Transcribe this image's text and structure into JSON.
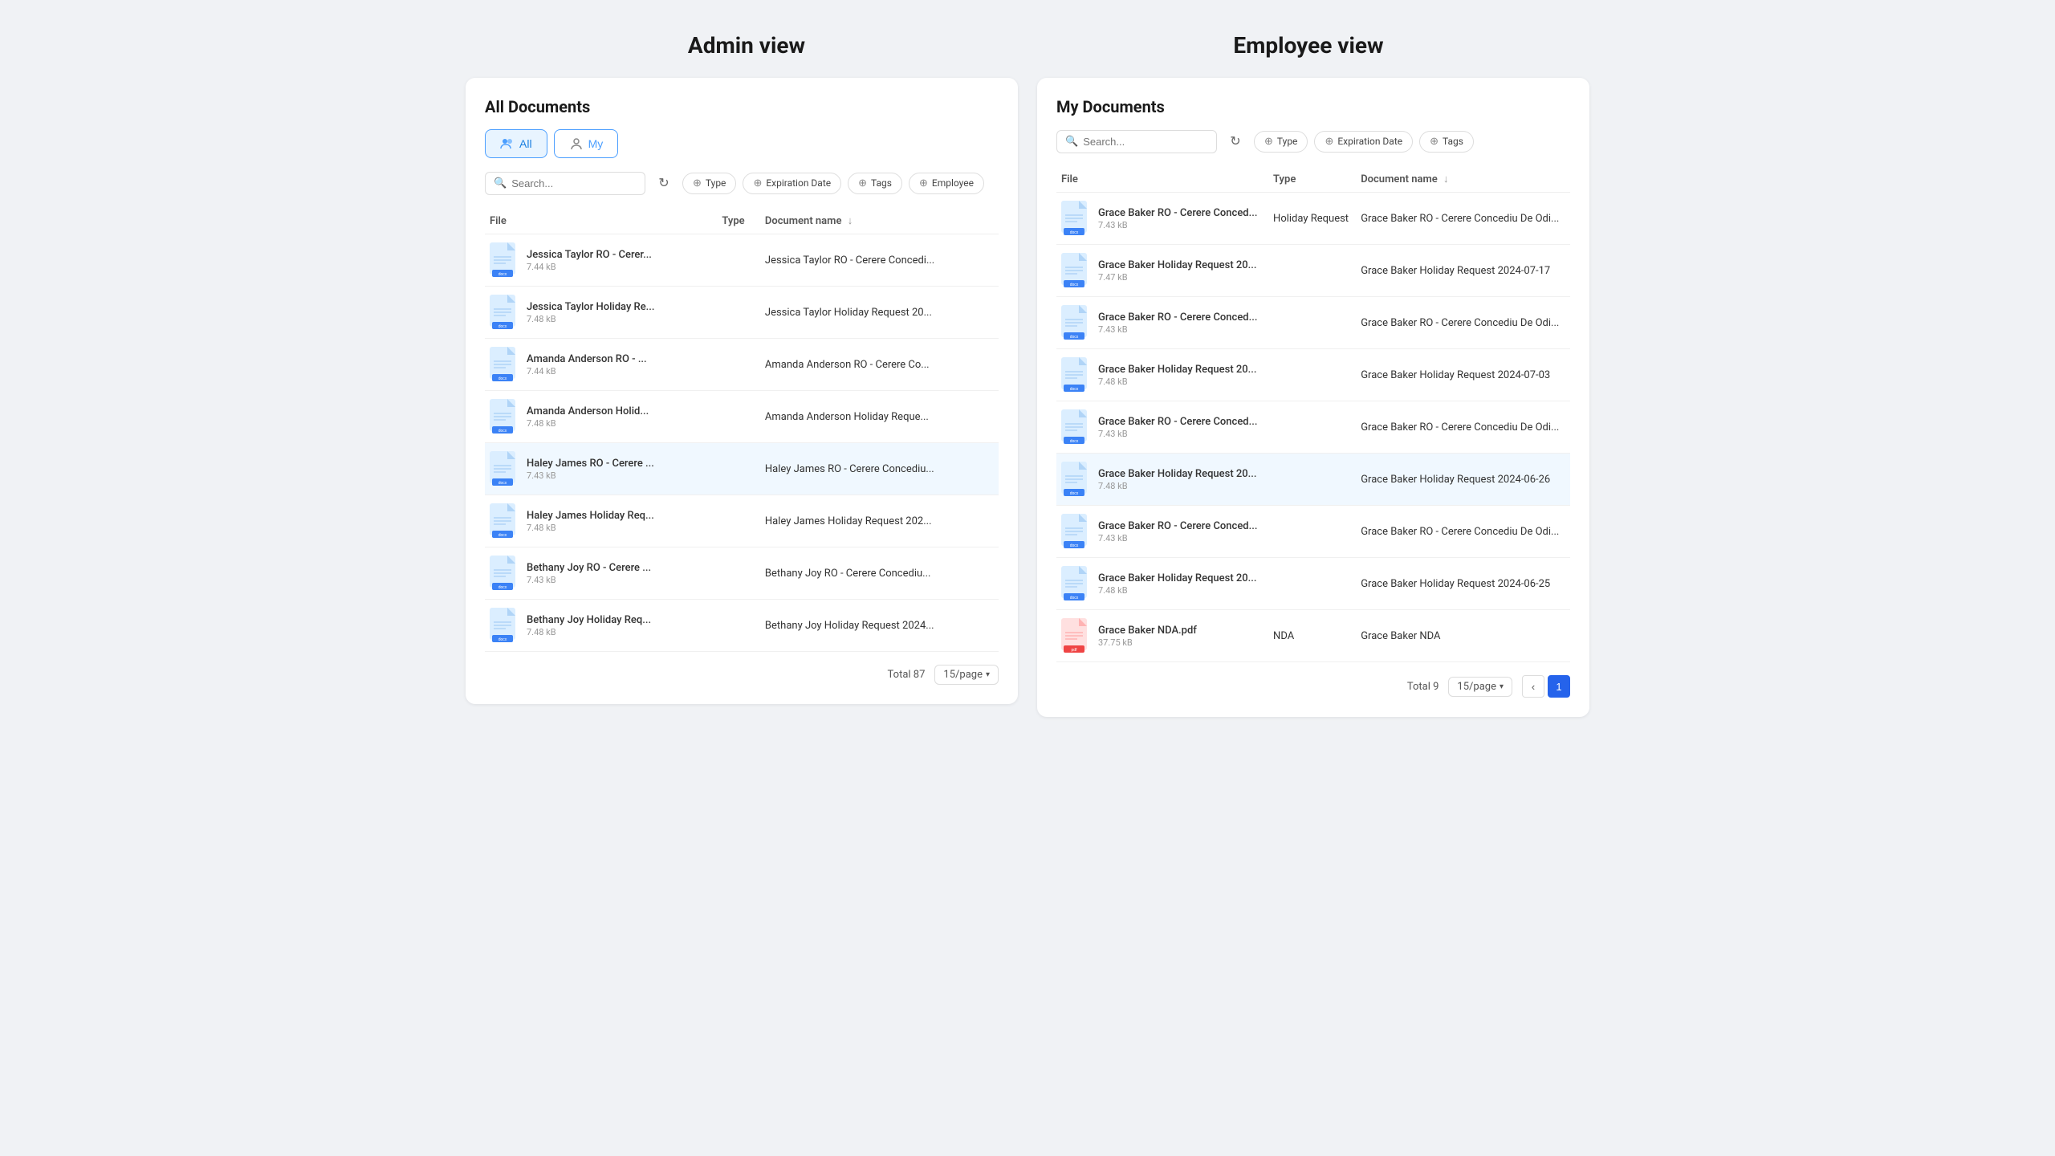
{
  "page": {
    "admin_view_title": "Admin view",
    "employee_view_title": "Employee view"
  },
  "admin_panel": {
    "title": "All Documents",
    "toggle_all": "All",
    "toggle_my": "My",
    "search_placeholder": "Search...",
    "filter_type": "Type",
    "filter_expiration": "Expiration Date",
    "filter_tags": "Tags",
    "filter_employee": "Employee",
    "col_file": "File",
    "col_type": "Type",
    "col_doc_name": "Document name",
    "total_label": "Total 87",
    "per_page": "15/page",
    "files": [
      {
        "name": "Jessica Taylor RO - Cerer...",
        "size": "7.44 kB",
        "doc_name": "Jessica Taylor RO - Cerere Concedi...",
        "highlighted": false
      },
      {
        "name": "Jessica Taylor Holiday Re...",
        "size": "7.48 kB",
        "doc_name": "Jessica Taylor Holiday Request 20...",
        "highlighted": false
      },
      {
        "name": "Amanda Anderson RO - ...",
        "size": "7.44 kB",
        "doc_name": "Amanda Anderson RO - Cerere Co...",
        "highlighted": false
      },
      {
        "name": "Amanda Anderson Holid...",
        "size": "7.48 kB",
        "doc_name": "Amanda Anderson Holiday Reque...",
        "highlighted": false
      },
      {
        "name": "Haley James RO - Cerere ...",
        "size": "7.43 kB",
        "doc_name": "Haley James RO - Cerere Concediu...",
        "highlighted": true
      },
      {
        "name": "Haley James Holiday Req...",
        "size": "7.48 kB",
        "doc_name": "Haley James Holiday Request 202...",
        "highlighted": false
      },
      {
        "name": "Bethany Joy RO - Cerere ...",
        "size": "7.43 kB",
        "doc_name": "Bethany Joy RO - Cerere Concediu...",
        "highlighted": false
      },
      {
        "name": "Bethany Joy Holiday Req...",
        "size": "7.48 kB",
        "doc_name": "Bethany Joy Holiday Request 2024...",
        "highlighted": false
      }
    ]
  },
  "employee_panel": {
    "title": "My Documents",
    "search_placeholder": "Search...",
    "filter_type": "Type",
    "filter_expiration": "Expiration Date",
    "filter_tags": "Tags",
    "col_file": "File",
    "col_type": "Type",
    "col_doc_name": "Document name",
    "total_label": "Total 9",
    "per_page": "15/page",
    "current_page": "1",
    "files": [
      {
        "name": "Grace Baker RO - Cerere Conced...",
        "size": "7.43 kB",
        "type": "Holiday Request",
        "doc_name": "Grace Baker RO - Cerere Concediu De Odi...",
        "highlighted": false,
        "nda": false
      },
      {
        "name": "Grace Baker Holiday Request 20...",
        "size": "7.47 kB",
        "type": "",
        "doc_name": "Grace Baker Holiday Request 2024-07-17",
        "highlighted": false,
        "nda": false
      },
      {
        "name": "Grace Baker RO - Cerere Conced...",
        "size": "7.43 kB",
        "type": "",
        "doc_name": "Grace Baker RO - Cerere Concediu De Odi...",
        "highlighted": false,
        "nda": false
      },
      {
        "name": "Grace Baker Holiday Request 20...",
        "size": "7.48 kB",
        "type": "",
        "doc_name": "Grace Baker Holiday Request 2024-07-03",
        "highlighted": false,
        "nda": false
      },
      {
        "name": "Grace Baker RO - Cerere Conced...",
        "size": "7.43 kB",
        "type": "",
        "doc_name": "Grace Baker RO - Cerere Concediu De Odi...",
        "highlighted": false,
        "nda": false
      },
      {
        "name": "Grace Baker Holiday Request 20...",
        "size": "7.48 kB",
        "type": "",
        "doc_name": "Grace Baker Holiday Request 2024-06-26",
        "highlighted": true,
        "nda": false
      },
      {
        "name": "Grace Baker RO - Cerere Conced...",
        "size": "7.43 kB",
        "type": "",
        "doc_name": "Grace Baker RO - Cerere Concediu De Odi...",
        "highlighted": false,
        "nda": false
      },
      {
        "name": "Grace Baker Holiday Request 20...",
        "size": "7.48 kB",
        "type": "",
        "doc_name": "Grace Baker Holiday Request 2024-06-25",
        "highlighted": false,
        "nda": false
      },
      {
        "name": "Grace Baker NDA.pdf",
        "size": "37.75 kB",
        "type": "NDA",
        "doc_name": "Grace Baker NDA",
        "highlighted": false,
        "nda": true
      }
    ]
  }
}
